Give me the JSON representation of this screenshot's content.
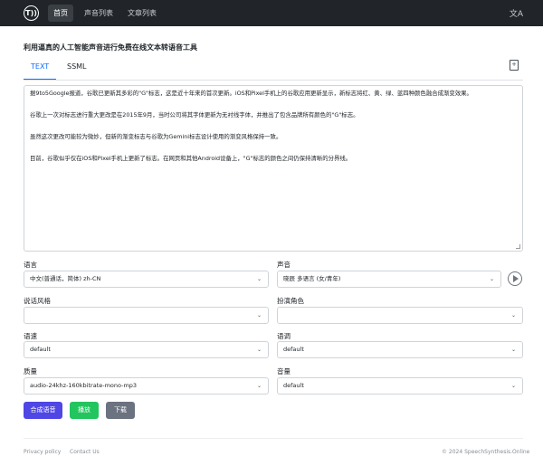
{
  "nav": {
    "logo_text": "T))",
    "items": [
      {
        "label": "首页",
        "active": true
      },
      {
        "label": "声音列表",
        "active": false
      },
      {
        "label": "文章列表",
        "active": false
      }
    ],
    "lang_icon": "文A"
  },
  "page_title": "利用逼真的人工智能声音进行免费在线文本转语音工具",
  "tabs": [
    {
      "label": "TEXT",
      "active": true
    },
    {
      "label": "SSML",
      "active": false
    }
  ],
  "text_content": [
    "据9to5Google报道，谷歌已更新其多彩的\"G\"标志，这是近十年来的首次更新。iOS和Pixel手机上的谷歌应用更新显示，新标志将红、黄、绿、蓝四种颜色融合成渐变效果。",
    "谷歌上一次对标志进行重大更改是在2015年9月，当时公司将其字体更新为无衬线字体，并推出了包含品牌所有颜色的\"G\"标志。",
    "虽然这次更改可能较为微妙，但新的渐变标志与谷歌为Gemini标志设计使用的渐变风格保持一致。",
    "目前，谷歌似乎仅在iOS和Pixel手机上更新了标志。在网页和其他Android设备上，\"G\"标志的颜色之间仍保持清晰的分界线。"
  ],
  "form": {
    "language_label": "语言",
    "language_value": "中文(普通话，简体) zh-CN",
    "voice_label": "声音",
    "voice_value": "晓辰 多语言 (女/青年)",
    "style_label": "说话风格",
    "style_value": "",
    "role_label": "扮演角色",
    "role_value": "",
    "rate_label": "语速",
    "rate_value": "default",
    "pitch_label": "语调",
    "pitch_value": "default",
    "quality_label": "质量",
    "quality_value": "audio-24khz-160kbitrate-mono-mp3",
    "volume_label": "音量",
    "volume_value": "default"
  },
  "buttons": {
    "synthesize": "合成语音",
    "play": "播放",
    "download": "下载"
  },
  "colors": {
    "synthesize": "#4f46e5",
    "play": "#22c55e",
    "download": "#6b7280"
  },
  "footer": {
    "privacy": "Privacy policy",
    "contact": "Contact Us",
    "copyright": "© 2024 SpeechSynthesis.Online"
  }
}
